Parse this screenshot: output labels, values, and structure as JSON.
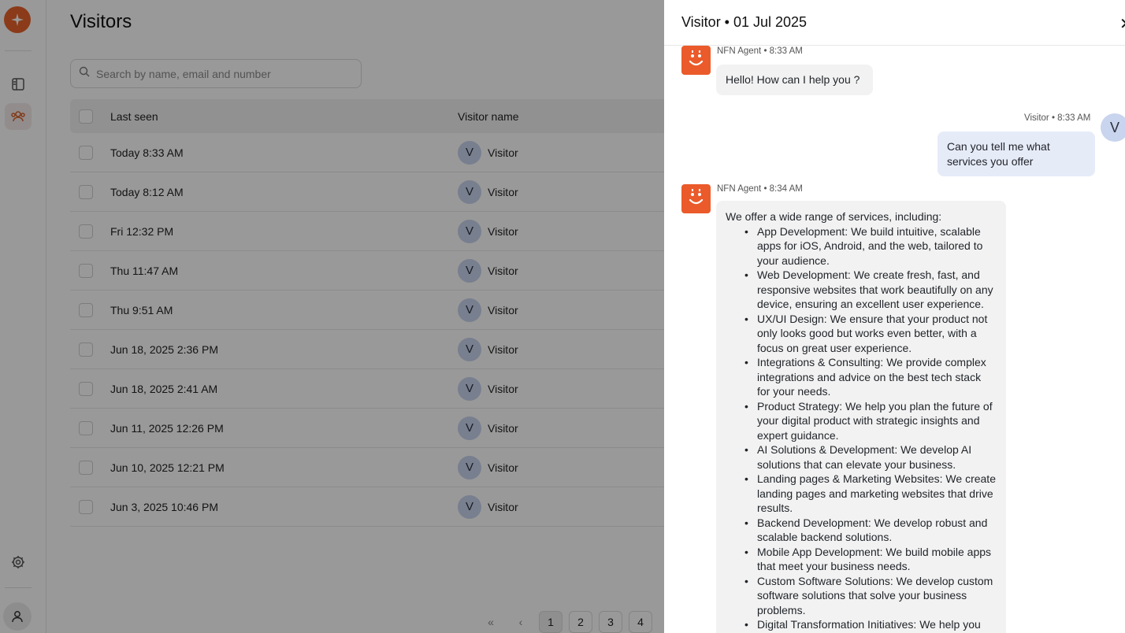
{
  "page": {
    "title": "Visitors",
    "search_placeholder": "Search by name, email and number",
    "columns": {
      "last_seen": "Last seen",
      "visitor_name": "Visitor name"
    },
    "rows": [
      {
        "last_seen": "Today 8:33 AM",
        "initial": "V",
        "name": "Visitor"
      },
      {
        "last_seen": "Today 8:12 AM",
        "initial": "V",
        "name": "Visitor"
      },
      {
        "last_seen": "Fri 12:32 PM",
        "initial": "V",
        "name": "Visitor"
      },
      {
        "last_seen": "Thu 11:47 AM",
        "initial": "V",
        "name": "Visitor"
      },
      {
        "last_seen": "Thu 9:51 AM",
        "initial": "V",
        "name": "Visitor"
      },
      {
        "last_seen": "Jun 18, 2025 2:36 PM",
        "initial": "V",
        "name": "Visitor"
      },
      {
        "last_seen": "Jun 18, 2025 2:41 AM",
        "initial": "V",
        "name": "Visitor"
      },
      {
        "last_seen": "Jun 11, 2025 12:26 PM",
        "initial": "V",
        "name": "Visitor"
      },
      {
        "last_seen": "Jun 10, 2025 12:21 PM",
        "initial": "V",
        "name": "Visitor"
      },
      {
        "last_seen": "Jun 3, 2025 10:46 PM",
        "initial": "V",
        "name": "Visitor"
      }
    ],
    "pagination": {
      "first": "«",
      "prev": "‹",
      "pages": [
        "1",
        "2",
        "3",
        "4"
      ],
      "current": "1"
    }
  },
  "drawer": {
    "title": "Visitor • 01 Jul 2025",
    "close": "✕",
    "messages": {
      "m1_meta": "NFN Agent • 8:33 AM",
      "m1_text": "Hello! How can I help you ?",
      "m2_meta": "Visitor • 8:33 AM",
      "m2_avatar": "V",
      "m2_text": "Can you tell me what services you offer",
      "m3_meta": "NFN Agent • 8:34 AM",
      "m3_intro": "We offer a wide range of services, including:",
      "m3_items": [
        "App Development: We build intuitive, scalable apps for iOS, Android, and the web, tailored to your audience.",
        "Web Development: We create fresh, fast, and responsive websites that work beautifully on any device, ensuring an excellent user experience.",
        "UX/UI Design: We ensure that your product not only looks good but works even better, with a focus on great user experience.",
        "Integrations & Consulting: We provide complex integrations and advice on the best tech stack for your needs.",
        "Product Strategy: We help you plan the future of your digital product with strategic insights and expert guidance.",
        "AI Solutions & Development: We develop AI solutions that can elevate your business.",
        "Landing pages & Marketing Websites: We create landing pages and marketing websites that drive results.",
        "Backend Development: We develop robust and scalable backend solutions.",
        "Mobile App Development: We build mobile apps that meet your business needs.",
        "Custom Software Solutions: We develop custom software solutions that solve your business problems.",
        "Digital Transformation Initiatives: We help you"
      ]
    }
  },
  "icons": {
    "logo": "sparkle-logo-icon",
    "nav1": "panel-layout-icon",
    "nav2": "users-icon",
    "settings": "gear-icon",
    "profile": "user-icon",
    "bot": "bot-smile-icon",
    "search": "search-icon"
  },
  "colors": {
    "brand": "#E8632C",
    "bot": "#EB5A2A",
    "visitor_avatar": "#C9D4EE",
    "user_bubble": "#E6EBF8"
  }
}
